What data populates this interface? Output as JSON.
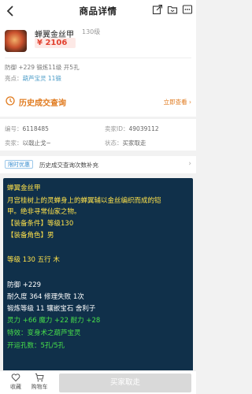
{
  "header": {
    "title": "商品详情"
  },
  "item": {
    "name": "蝉翼金丝甲",
    "level": "130级",
    "price": "¥ 2106",
    "stats": "防御 +229 锻炼11级 开5孔",
    "highlight_label": "亮点：",
    "highlight_value_1": "葫芦宝灵",
    "highlight_value_2": "11锻"
  },
  "history": {
    "title": "历史成交查询",
    "link": "立即查看 ›"
  },
  "seller": {
    "id_label": "编号：",
    "id_value": "6118485",
    "seller_id_label": "卖家ID：",
    "seller_id_value": "49039112",
    "seller_label": "卖家：",
    "seller_value": "以戟止戈~",
    "status_label": "状态：",
    "status_value": "买家取走"
  },
  "promo": {
    "badge": "限时优惠",
    "text": "历史成交查询次数补充",
    "chevron": "›"
  },
  "description": {
    "lines": [
      {
        "text": "蝉翼金丝甲",
        "color": "yellow"
      },
      {
        "text": "月宫桂树上的灵蝉身上的蝉翼辅以金丝编织而成的铠",
        "color": "yellow"
      },
      {
        "text": "甲。绝非寻常仙家之物。",
        "color": "yellow"
      },
      {
        "text": "【装备条件】等级130",
        "color": "yellow"
      },
      {
        "text": "【装备角色】男",
        "color": "yellow"
      },
      {
        "text": "等级 130 五行 木",
        "color": "yellow"
      },
      {
        "text": "防御 +229",
        "color": "white"
      },
      {
        "text": "耐久度 364 修理失败 1次",
        "color": "white"
      },
      {
        "text": "锻炼等级 11 镶嵌宝石 舍利子",
        "color": "white"
      },
      {
        "text": "灵力 +66 魔力 +22 耐力 +28",
        "color": "green"
      },
      {
        "text": "特效：变身术之葫芦宝灵",
        "color": "green"
      },
      {
        "text": "开运孔数：5孔/5孔",
        "color": "green"
      }
    ]
  },
  "bottom": {
    "favorite_label": "收藏",
    "cart_label": "购物车",
    "buy_label": "买家取走"
  },
  "colors": {
    "price_red": "#e2412f",
    "history_orange": "#e07a1e",
    "panel_bg": "#10304a",
    "desc_yellow": "#ffe24a",
    "desc_green": "#48e04a"
  }
}
